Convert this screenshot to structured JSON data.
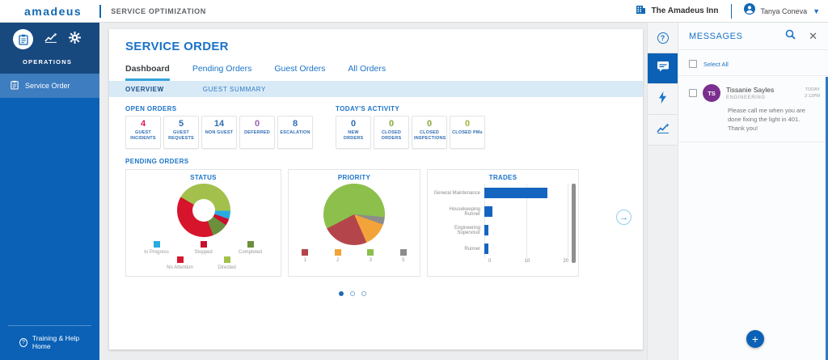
{
  "topbar": {
    "logo": "amadeus",
    "app_title": "SERVICE OPTIMIZATION",
    "property": "The Amadeus Inn",
    "user": "Tanya Coneva"
  },
  "sidebar": {
    "section_label": "OPERATIONS",
    "item_service_order": "Service Order",
    "footer": "Training & Help Home"
  },
  "page": {
    "title": "SERVICE ORDER",
    "tabs": [
      "Dashboard",
      "Pending Orders",
      "Guest Orders",
      "All Orders"
    ],
    "active_tab": "Dashboard",
    "subtabs": [
      "OVERVIEW",
      "GUEST SUMMARY"
    ],
    "active_subtab": "OVERVIEW"
  },
  "stats": {
    "open_orders": {
      "label": "OPEN ORDERS",
      "cards": [
        {
          "value": "4",
          "label": "GUEST INCIDENTS",
          "color": "#dc1a59"
        },
        {
          "value": "5",
          "label": "GUEST REQUESTS",
          "color": "#2e6db4"
        },
        {
          "value": "14",
          "label": "NON GUEST",
          "color": "#2e6db4"
        },
        {
          "value": "0",
          "label": "DEFERRED",
          "color": "#a05fb5"
        },
        {
          "value": "8",
          "label": "ESCALATION",
          "color": "#2e6db4"
        }
      ]
    },
    "todays_activity": {
      "label": "TODAY'S ACTIVITY",
      "cards": [
        {
          "value": "0",
          "label": "NEW ORDERS",
          "color": "#2e6db4"
        },
        {
          "value": "0",
          "label": "CLOSED ORDERS",
          "color": "#8aa83d"
        },
        {
          "value": "0",
          "label": "CLOSED INSPECTIONS",
          "color": "#8aa83d"
        },
        {
          "value": "0",
          "label": "CLOSED PMs",
          "color": "#a9b63c"
        }
      ]
    }
  },
  "pending_orders": {
    "label": "PENDING ORDERS"
  },
  "chart_data": [
    {
      "type": "pie",
      "variant": "donut",
      "title": "STATUS",
      "start_angle": -60,
      "legend_position": "bottom",
      "segments": [
        {
          "label": "Directed",
          "value": 42,
          "color": "#a3c04d"
        },
        {
          "label": "In Progress",
          "value": 5,
          "color": "#29abe2"
        },
        {
          "label": "Stopped",
          "value": 4,
          "color": "#c9102f"
        },
        {
          "label": "Completed",
          "value": 10,
          "color": "#6b8f3c"
        },
        {
          "label": "No Attention",
          "value": 39,
          "color": "#d6152c"
        }
      ],
      "legend_rows": [
        [
          "In Progress",
          "Stopped",
          "Completed"
        ],
        [
          "No Attention",
          "Directed"
        ]
      ]
    },
    {
      "type": "pie",
      "variant": "pie",
      "title": "PRIORITY",
      "start_angle": 95,
      "legend_position": "bottom",
      "segments": [
        {
          "label": "5",
          "value": 4,
          "color": "#8c8c8c"
        },
        {
          "label": "2",
          "value": 13,
          "color": "#f2a33a"
        },
        {
          "label": "1",
          "value": 24,
          "color": "#b4464b"
        },
        {
          "label": "3",
          "value": 59,
          "color": "#8cbf4c"
        }
      ],
      "legend_rows": [
        [
          "1",
          "2",
          "3",
          "5"
        ]
      ]
    },
    {
      "type": "bar",
      "orientation": "horizontal",
      "title": "TRADES",
      "categories": [
        "General Maintenance",
        "Housekeeping Runner",
        "Engineering Supervisor",
        "Runner"
      ],
      "values": [
        15,
        2,
        1,
        1
      ],
      "xlim": [
        0,
        20
      ],
      "xticks": [
        0,
        10,
        20
      ],
      "bar_color": "#1565c0",
      "grid": true
    }
  ],
  "carousel": {
    "dot_count": 3,
    "active_dot": 0,
    "next_arrow": "→"
  },
  "messages": {
    "title": "MESSAGES",
    "select_all": "Select All",
    "items": [
      {
        "initials": "TS",
        "name": "Tissanie Sayles",
        "department": "ENGINEERING",
        "time_line1": "TODAY",
        "time_line2": "2:12PM",
        "body": "Please call me when you are done fixing the light in 401. Thank you!",
        "avatar_color": "#7b2f8f"
      }
    ],
    "add_label": "+"
  }
}
